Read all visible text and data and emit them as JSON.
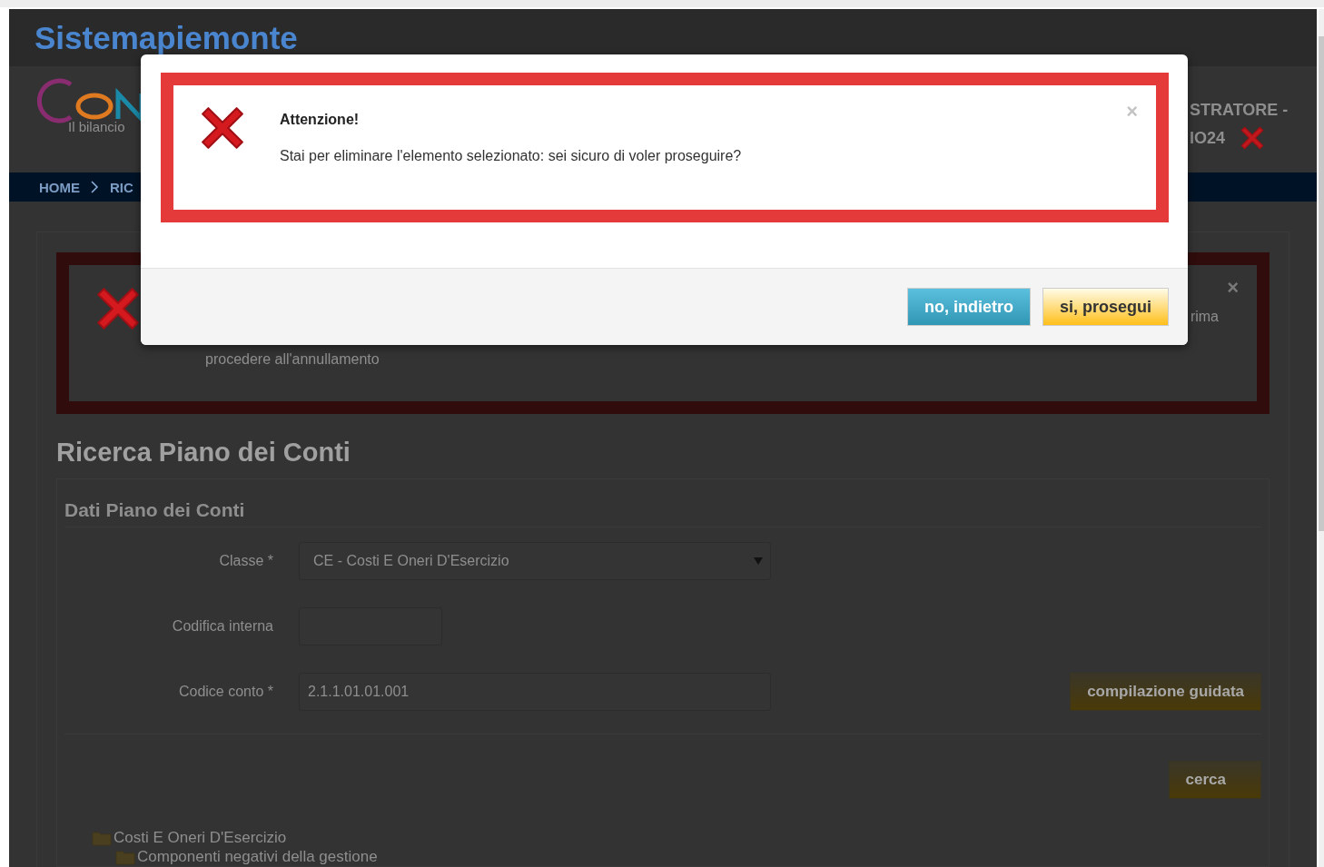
{
  "header": {
    "title": "Sistemapiemonte",
    "logo_tagline": "Il bilancio",
    "user_line_1": "STRATORE -",
    "user_line_2": "IO24"
  },
  "breadcrumb": [
    {
      "label": "HOME"
    },
    {
      "label": "RIC"
    }
  ],
  "alert": {
    "text_line_1": "rima",
    "text_line_2": "procedere all'annullamento",
    "close_symbol": "×"
  },
  "page_title": "Ricerca Piano dei Conti",
  "panel": {
    "title": "Dati Piano dei Conti",
    "fields": [
      {
        "kind": "select",
        "label": "Classe *",
        "value": "CE - Costi E Oneri D'Esercizio"
      },
      {
        "kind": "short",
        "label": "Codifica interna"
      },
      {
        "kind": "text",
        "label": "Codice conto *",
        "value": "2.1.1.01.01.001",
        "action": "compilazione guidata"
      }
    ],
    "search_button": "cerca"
  },
  "tree": [
    {
      "label": "Costi E Oneri D'Esercizio",
      "children": [
        {
          "label": "Componenti negativi della gestione"
        }
      ]
    }
  ],
  "dialog": {
    "title": "Attenzione!",
    "close_symbol": "×",
    "message": "Stai per eliminare l'elemento selezionato: sei sicuro di voler proseguire?",
    "buttons": [
      {
        "label": "no, indietro",
        "kind": "info"
      },
      {
        "label": "si, prosegui",
        "kind": "warning"
      }
    ]
  }
}
